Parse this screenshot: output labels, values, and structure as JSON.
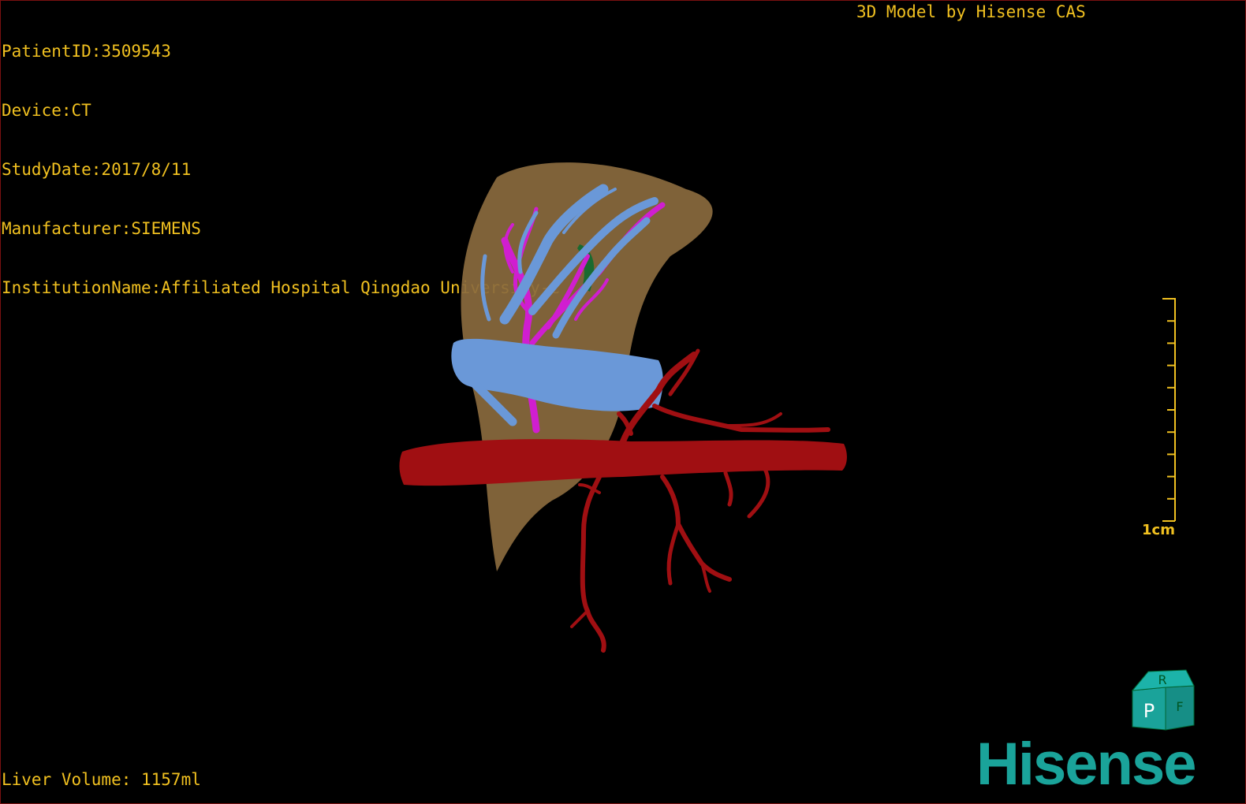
{
  "info": {
    "patient_id": "PatientID:3509543",
    "device": "Device:CT",
    "study_date": "StudyDate:2017/8/11",
    "manufacturer": "Manufacturer:SIEMENS",
    "institution": "InstitutionName:Affiliated Hospital Qingdao University-C"
  },
  "title": "3D Model by Hisense CAS",
  "scale_label": "1cm",
  "volume": "Liver Volume: 1157ml",
  "brand": "Hisense",
  "orientation_cube": {
    "faces": [
      "R",
      "P",
      "F"
    ],
    "color": "#1aa39a"
  },
  "colors": {
    "overlay_text": "#f0c020",
    "liver": "#8a6a3e",
    "portal_vein": "#6a98d8",
    "hepatic_vein": "#d01ed0",
    "artery": "#a00f12",
    "brand": "#1aa39a"
  }
}
